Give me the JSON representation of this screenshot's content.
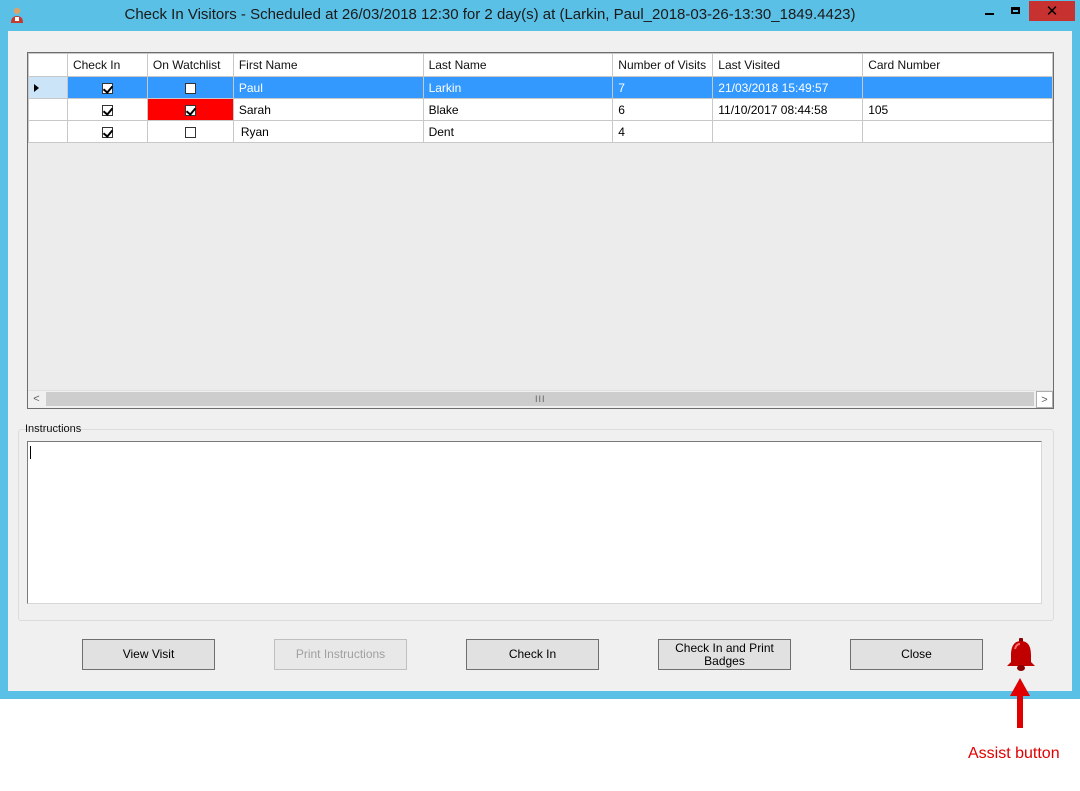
{
  "window": {
    "title": "Check In Visitors - Scheduled at 26/03/2018 12:30 for 2 day(s) at  (Larkin, Paul_2018-03-26-13:30_1849.4423)",
    "close_symbol": "✕"
  },
  "grid": {
    "columns": [
      "Check In",
      "On Watchlist",
      "First Name",
      "Last Name",
      "Number of Visits",
      "Last Visited",
      "Card Number"
    ],
    "rows": [
      {
        "check_in": true,
        "on_watchlist": false,
        "first_name": "Paul",
        "last_name": "Larkin",
        "visits": "7",
        "last_visited": "21/03/2018 15:49:57",
        "card_number": "",
        "selected": true
      },
      {
        "check_in": true,
        "on_watchlist": true,
        "first_name": "Sarah",
        "last_name": "Blake",
        "visits": "6",
        "last_visited": "11/10/2017 08:44:58",
        "card_number": "105",
        "selected": false
      },
      {
        "check_in": true,
        "on_watchlist": false,
        "first_name": "Ryan",
        "last_name": "Dent",
        "visits": "4",
        "last_visited": "",
        "card_number": "",
        "selected": false
      }
    ],
    "scroll_left": "<",
    "scroll_right": ">",
    "scroll_grip": "III"
  },
  "instructions": {
    "label": "Instructions",
    "value": ""
  },
  "buttons": {
    "view_visit": "View Visit",
    "print_instructions": "Print Instructions",
    "check_in": "Check In",
    "check_in_print_line1": "Check In and Print",
    "check_in_print_line2": "Badges",
    "close": "Close"
  },
  "annotation": {
    "assist_label": "Assist button"
  },
  "colors": {
    "frame": "#5bc0e6",
    "selected_row": "#3399ff",
    "watchlist_flag": "#ff0000",
    "bell": "#c00000",
    "annotation": "#e00000"
  },
  "icons": {
    "app": "visitor-app-icon",
    "assist": "bell-icon",
    "annotation_arrow": "arrow-up-icon"
  }
}
